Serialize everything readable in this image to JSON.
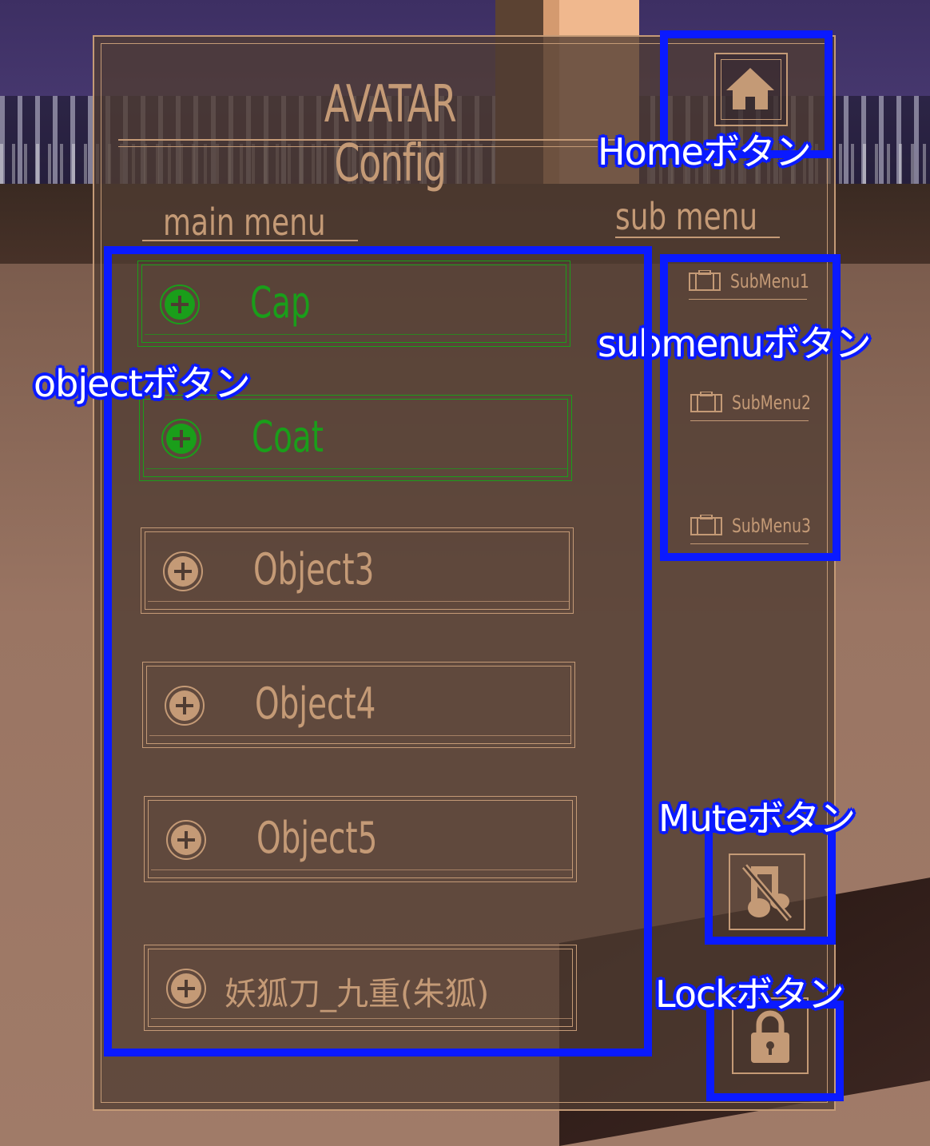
{
  "panel": {
    "title": "AVATAR Config",
    "main_menu_label": "main menu",
    "sub_menu_label": "sub menu"
  },
  "objects": [
    {
      "label": "Cap",
      "active": true
    },
    {
      "label": "Coat",
      "active": true
    },
    {
      "label": "Object3",
      "active": false
    },
    {
      "label": "Object4",
      "active": false
    },
    {
      "label": "Object5",
      "active": false
    },
    {
      "label": "妖狐刀_九重(朱狐)",
      "active": false
    }
  ],
  "submenus": [
    {
      "label": "SubMenu1"
    },
    {
      "label": "SubMenu2"
    },
    {
      "label": "SubMenu3"
    }
  ],
  "icons": {
    "home": "home-icon",
    "mute": "music-off-icon",
    "lock": "lock-icon",
    "object": "plus-circle-icon",
    "submenu": "briefcase-icon"
  },
  "annotations": {
    "home": "Homeボタン",
    "submenu": "submenuボタン",
    "object": "objectボタン",
    "mute": "Muteボタン",
    "lock": "Lockボタン"
  },
  "colors": {
    "accent": "#c49a76",
    "active": "#1a9e1a",
    "annotation": "#0a1aff"
  }
}
